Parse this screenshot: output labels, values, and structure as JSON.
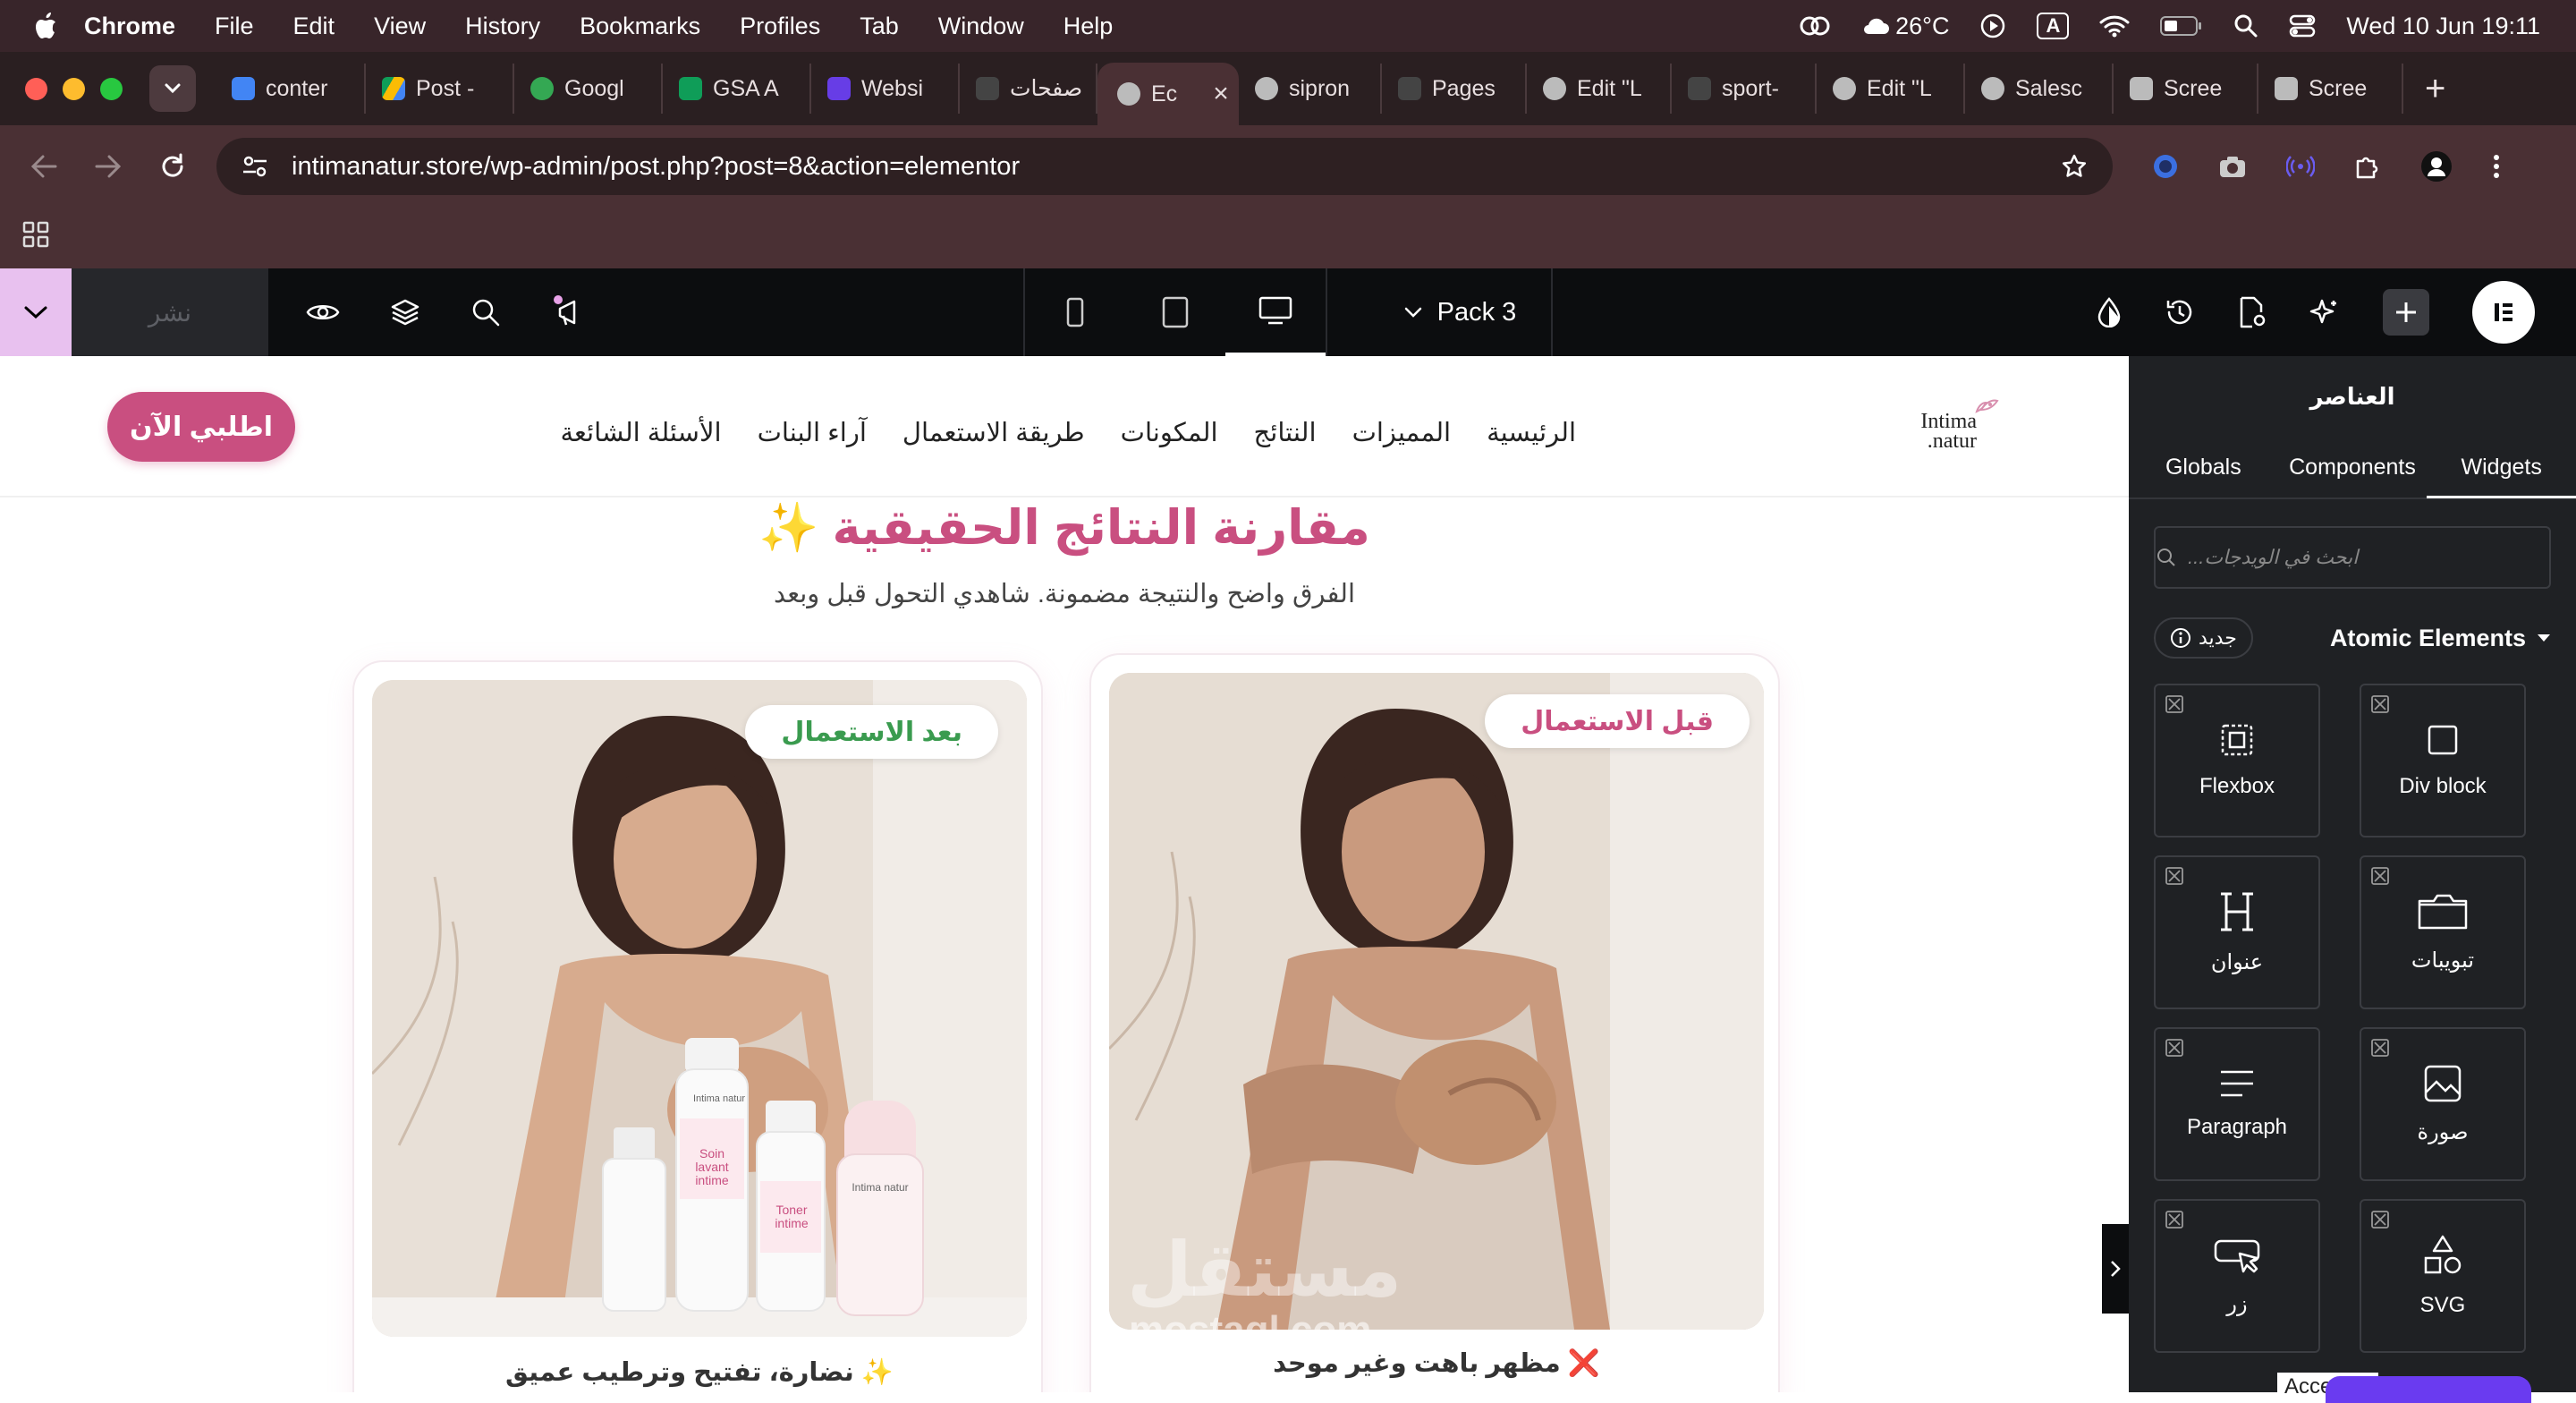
{
  "mac_menu": {
    "app": "Chrome",
    "items": [
      "File",
      "Edit",
      "View",
      "History",
      "Bookmarks",
      "Profiles",
      "Tab",
      "Window",
      "Help"
    ],
    "weather": "26°C",
    "input_badge": "A",
    "datetime": "Wed 10 Jun  19:11"
  },
  "tabs": [
    {
      "label": "conter",
      "icon": "google-docs-icon",
      "color": "#4285f4"
    },
    {
      "label": "Post -",
      "icon": "google-drive-icon",
      "color": "#fbbc04"
    },
    {
      "label": "Googl",
      "icon": "google-meet-icon",
      "color": "#34a853"
    },
    {
      "label": "GSA A",
      "icon": "google-sheets-icon",
      "color": "#0f9d58"
    },
    {
      "label": "Websi",
      "icon": "hostinger-icon",
      "color": "#673de6"
    },
    {
      "label": "صفحات",
      "icon": "pages-icon",
      "color": "#444"
    },
    {
      "label": "Ec",
      "icon": "globe-icon",
      "color": "#bbb",
      "active": true
    },
    {
      "label": "sipron",
      "icon": "globe-icon",
      "color": "#bbb"
    },
    {
      "label": "Pages",
      "icon": "pages-icon",
      "color": "#444"
    },
    {
      "label": "Edit \"L",
      "icon": "globe-icon",
      "color": "#bbb"
    },
    {
      "label": "sport-",
      "icon": "pages-icon",
      "color": "#444"
    },
    {
      "label": "Edit \"L",
      "icon": "globe-icon",
      "color": "#bbb"
    },
    {
      "label": "Salesc",
      "icon": "globe-icon",
      "color": "#bbb"
    },
    {
      "label": "Scree",
      "icon": "camera-icon",
      "color": "#bbb"
    },
    {
      "label": "Scree",
      "icon": "camera-icon",
      "color": "#bbb"
    }
  ],
  "address": {
    "url": "intimanatur.store/wp-admin/post.php?post=8&action=elementor"
  },
  "editor": {
    "publish_label": "نشر",
    "pack_label": "Pack 3"
  },
  "site": {
    "brand_line1": "Intima",
    "brand_line2": "natur.",
    "menu": [
      "الرئيسية",
      "المميزات",
      "النتائج",
      "المكونات",
      "طريقة الاستعمال",
      "آراء البنات",
      "الأسئلة الشائعة"
    ],
    "cta": "اطلبي الآن",
    "section_title": "مقارنة النتائج الحقيقية ✨",
    "section_subtitle": "الفرق واضح والنتيجة مضمونة. شاهدي التحول قبل وبعد",
    "before_badge": "قبل الاستعمال",
    "after_badge": "بعد الاستعمال",
    "before_caption": "❌ مظهر باهت وغير موحد",
    "after_caption": "✨ نضارة، تفتيح وترطيب عميق",
    "product_labels": [
      "Intima natur",
      "Soin lavant intime",
      "Toner intime",
      "Intima natur"
    ]
  },
  "panel": {
    "title": "العناصر",
    "tabs": [
      "Globals",
      "Components",
      "Widgets"
    ],
    "active_tab": "Widgets",
    "search_placeholder": "ابحث في الويدجات...",
    "new_label": "جديد",
    "section_label": "Atomic Elements",
    "widgets": [
      {
        "label": "Flexbox",
        "icon": "flexbox-icon"
      },
      {
        "label": "Div block",
        "icon": "div-block-icon"
      },
      {
        "label": "عنوان",
        "icon": "heading-icon"
      },
      {
        "label": "تبويبات",
        "icon": "tabs-icon"
      },
      {
        "label": "Paragraph",
        "icon": "paragraph-icon"
      },
      {
        "label": "صورة",
        "icon": "image-icon"
      },
      {
        "label": "زر",
        "icon": "button-icon"
      },
      {
        "label": "SVG",
        "icon": "svg-shapes-icon"
      }
    ],
    "access_label": "Access a"
  },
  "watermark": {
    "arabic": "مستقل",
    "latin": "mostaql.com"
  },
  "colors": {
    "brand_pink": "#c94f80",
    "green_badge": "#3a9b4f",
    "editor_bg": "#0c0d0f",
    "panel_bg": "#1f2124"
  }
}
